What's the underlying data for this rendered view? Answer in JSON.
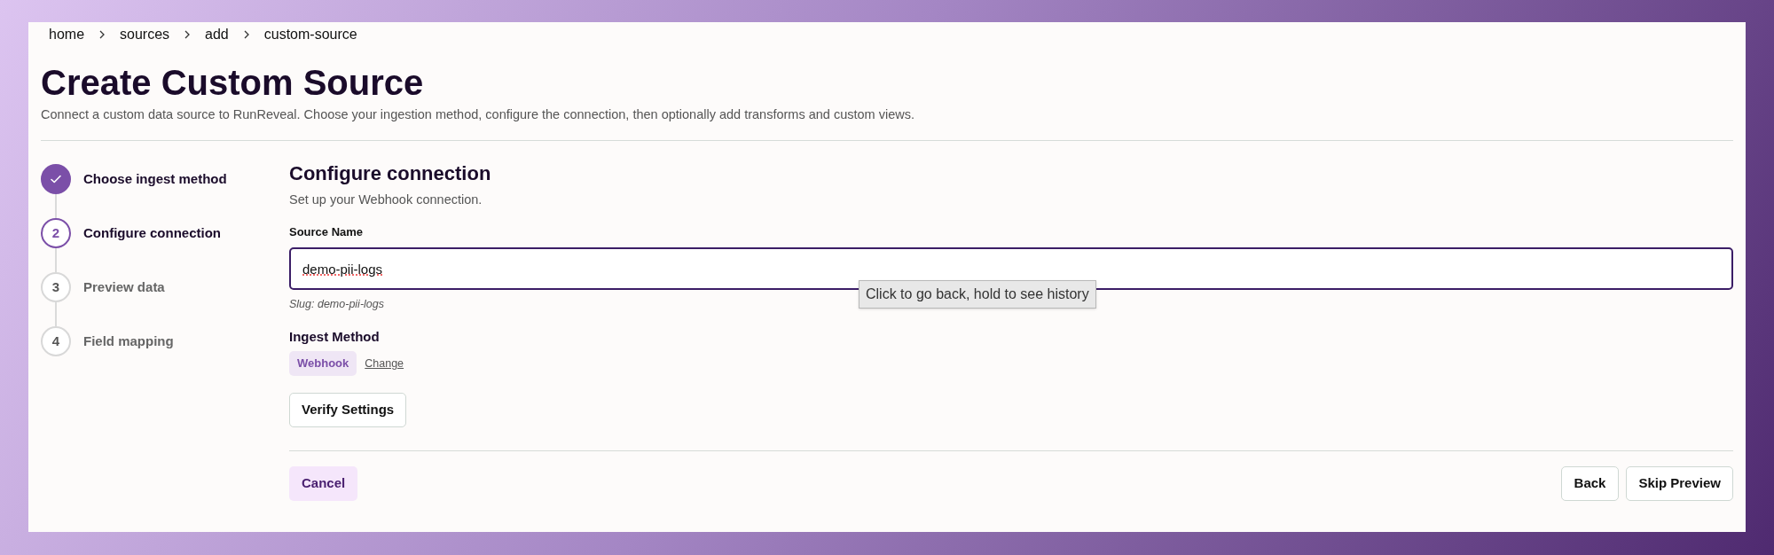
{
  "breadcrumb": [
    "home",
    "sources",
    "add",
    "custom-source"
  ],
  "title": "Create Custom Source",
  "description": "Connect a custom data source to RunReveal. Choose your ingestion method, configure the connection, then optionally add transforms and custom views.",
  "steps": [
    {
      "label": "Choose ingest method",
      "completed": true,
      "current": false
    },
    {
      "number": "2",
      "label": "Configure connection",
      "completed": false,
      "current": true
    },
    {
      "number": "3",
      "label": "Preview data",
      "completed": false,
      "current": false
    },
    {
      "number": "4",
      "label": "Field mapping",
      "completed": false,
      "current": false
    }
  ],
  "section": {
    "title": "Configure connection",
    "subtitle": "Set up your Webhook connection."
  },
  "source_name": {
    "label": "Source Name",
    "value": "demo-pii-logs",
    "focused": true,
    "slug": "Slug: demo-pii-logs"
  },
  "ingest_method": {
    "label": "Ingest Method",
    "value": "Webhook",
    "change_link": "Change"
  },
  "verify_button": "Verify Settings",
  "tooltip": "Click to go back, hold to see history",
  "footer": {
    "cancel": "Cancel",
    "back": "Back",
    "skip": "Skip Preview"
  }
}
